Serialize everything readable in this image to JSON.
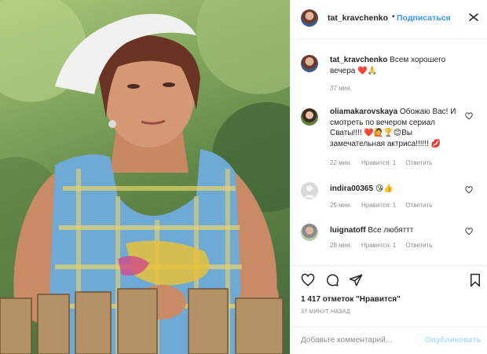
{
  "header": {
    "username": "tat_kravchenko",
    "separator": "•",
    "follow_label": "Подписаться"
  },
  "caption": {
    "username": "tat_kravchenko",
    "text": "Всем хорошего вечера ❤️🙏",
    "time": "37 мин."
  },
  "comments": [
    {
      "username": "oliamakarovskaya",
      "text": "Обожаю Вас! И смотреть по вечером сериал Сваты!!!! ❤️🙋🏆😊Вы замечательная актриса!!!!!! 💋",
      "time": "22 мин.",
      "likes": "Нравится: 1",
      "reply": "Ответить"
    },
    {
      "username": "indira00365",
      "text": "😘👍",
      "time": "25 мин.",
      "likes": "Нравится: 1",
      "reply": "Ответить"
    },
    {
      "username": "luignatoff",
      "text": "Все любяттт",
      "time": "28 мин.",
      "likes": "Нравится: 1",
      "reply": "Ответить"
    }
  ],
  "actions": {
    "likes_text": "1 417 отметок \"Нравится\"",
    "posted_ago": "37 МИНУТ НАЗАД"
  },
  "add_comment": {
    "placeholder": "Добавьте комментарий...",
    "publish_label": "Опубликовать"
  },
  "colors": {
    "link_blue": "#3897f0",
    "publish_disabled": "#b2dffc",
    "secondary_text": "#8e8e8e",
    "like_red": "#ed4956"
  }
}
